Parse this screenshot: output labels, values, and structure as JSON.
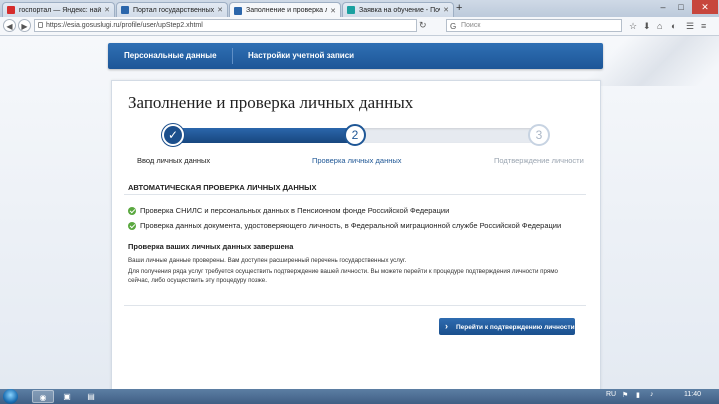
{
  "browser": {
    "tabs": [
      {
        "label": "госпортал — Яндекс: най...",
        "favicon_color": "#d62c2c",
        "active": false
      },
      {
        "label": "Портал государственных ...",
        "favicon_color": "#2b66ab",
        "active": false
      },
      {
        "label": "Заполнение и проверка л...",
        "favicon_color": "#2b66ab",
        "active": true
      },
      {
        "label": "Заявка на обучение - Поч...",
        "favicon_color": "#1aa0a0",
        "active": false
      }
    ],
    "new_tab": "+",
    "url": "https://esia.gosuslugi.ru/profile/user/upStep2.xhtml",
    "search_placeholder": "Поиск",
    "search_engine_icon": "G"
  },
  "topnav": {
    "items": [
      "Персональные данные",
      "Настройки учетной записи"
    ]
  },
  "card": {
    "title": "Заполнение и проверка личных данных",
    "steps": [
      {
        "number": "✓",
        "label": "Ввод личных данных",
        "state": "done"
      },
      {
        "number": "2",
        "label": "Проверка личных данных",
        "state": "current"
      },
      {
        "number": "3",
        "label": "Подтверждение личности",
        "state": "pending"
      }
    ],
    "progress_fraction": 0.52,
    "section_title": "АВТОМАТИЧЕСКАЯ ПРОВЕРКА ЛИЧНЫХ ДАННЫХ",
    "checks": [
      "Проверка СНИЛС и персональных данных в Пенсионном фонде Российской Федерации",
      "Проверка данных документа, удостоверяющего личность, в Федеральной миграционной службе Российской Федерации"
    ],
    "result_title": "Проверка ваших личных данных завершена",
    "result_lines": [
      "Ваши личные данные проверены. Вам доступен расширенный перечень государственных услуг.",
      "Для получения ряда услуг требуется осуществить подтверждение вашей личности. Вы можете перейти к процедуре подтверждения личности прямо",
      "сейчас, либо осуществить эту процедуру позже."
    ],
    "button_label": "Перейти к подтверждению личности"
  },
  "taskbar": {
    "language": "RU",
    "time": "11:40"
  },
  "colors": {
    "brand_blue": "#1d5697",
    "check_green": "#5aa83f"
  }
}
